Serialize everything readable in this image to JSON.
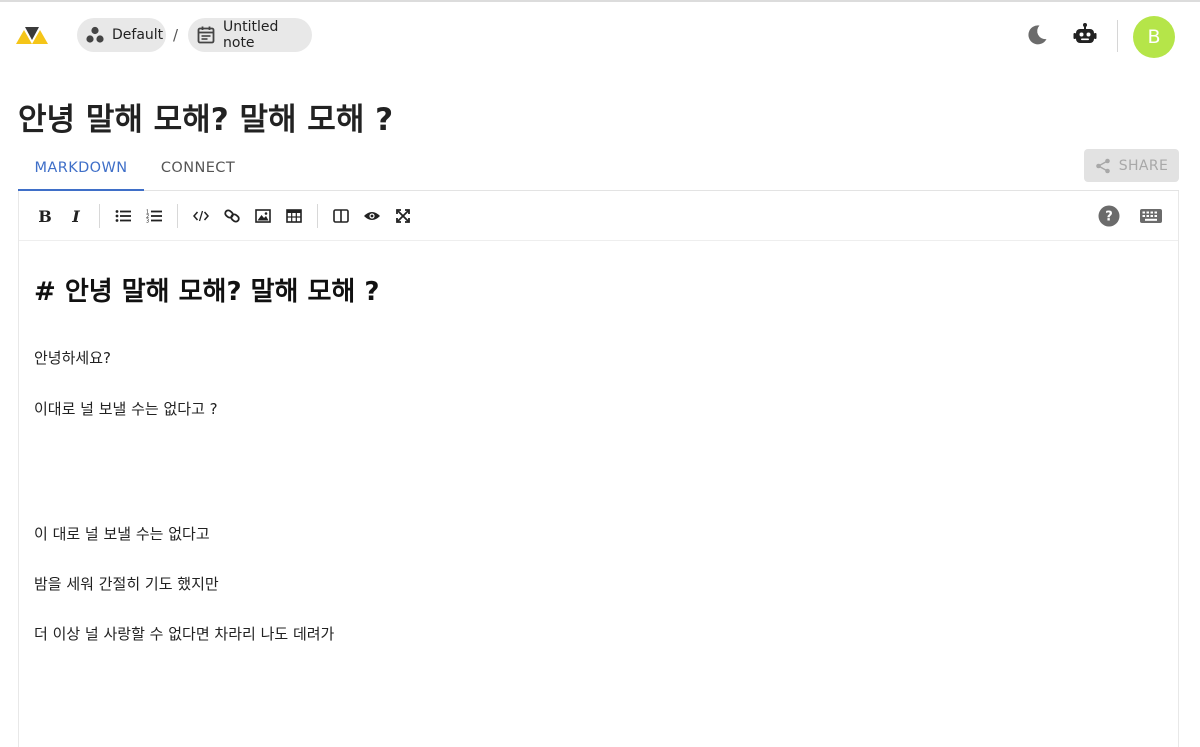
{
  "header": {
    "workspace_label": "Default",
    "note_label": "Untitled note",
    "separator": "/",
    "avatar_initial": "B",
    "avatar_color": "#b5e549"
  },
  "icons": {
    "logo": "app-logo",
    "workspace": "group-icon",
    "note": "calendar-note-icon",
    "theme": "moon-icon",
    "assistant": "robot-icon",
    "share": "share-icon",
    "help": "help-circle-icon",
    "keyboard": "keyboard-icon"
  },
  "page": {
    "title": "안녕 말해 모해? 말해 모해 ?"
  },
  "tabs": [
    {
      "label": "MARKDOWN",
      "active": true
    },
    {
      "label": "CONNECT",
      "active": false
    }
  ],
  "share": {
    "label": "SHARE",
    "enabled": false
  },
  "toolbar": {
    "bold": "B",
    "italic": "I",
    "tools": [
      "bold",
      "italic",
      "bulleted-list",
      "numbered-list",
      "code",
      "link",
      "image",
      "table",
      "side-by-side",
      "preview",
      "fullscreen"
    ]
  },
  "editor": {
    "heading": "# 안녕 말해 모해? 말해 모해 ?",
    "lines": [
      "안녕하세요?",
      "이대로 널 보낼 수는 없다고 ?",
      "이 대로 널 보낼 수는 없다고",
      "밤을 세워 간절히 기도 했지만",
      "더 이상 널 사랑할 수 없다면 차라리 나도 데려가"
    ]
  },
  "colors": {
    "accent": "#3f6fc8",
    "logo_yellow": "#f5c518",
    "logo_dark": "#3a3a3a"
  }
}
